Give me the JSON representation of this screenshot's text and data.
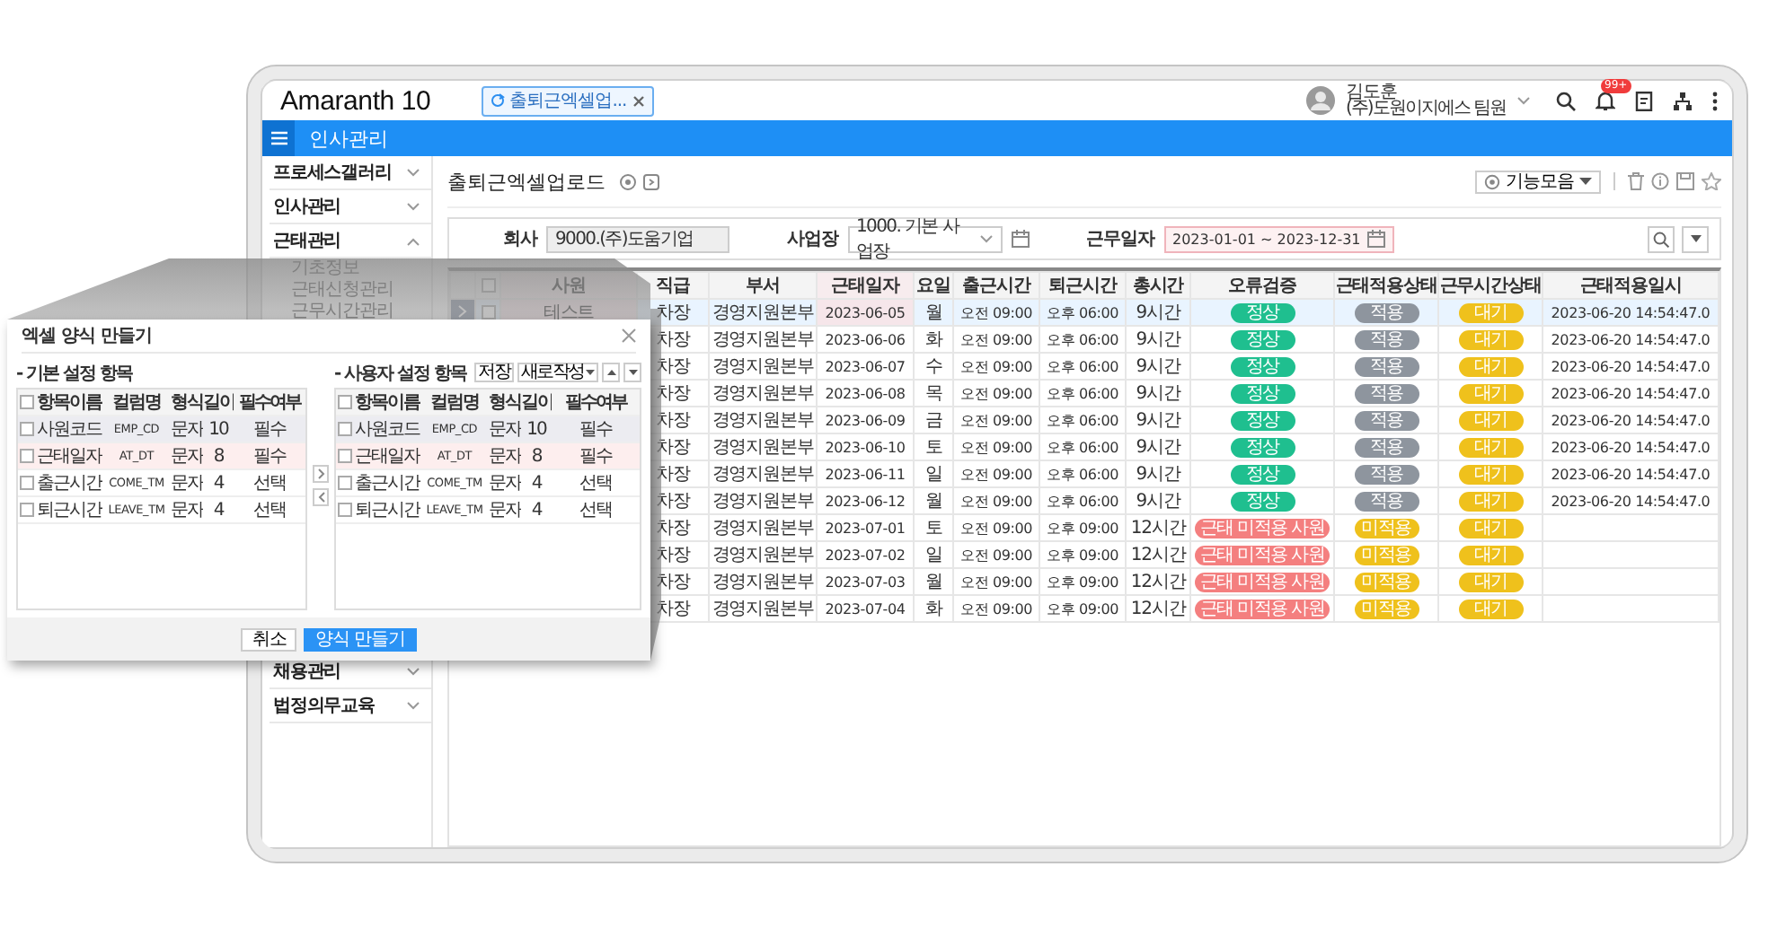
{
  "app": {
    "logo": "Amaranth 10",
    "tab": {
      "label": "출퇴근엑셀업...",
      "selected": true
    },
    "user": {
      "name": "김도훈",
      "company": "(주)도원이지에스 팀원"
    },
    "notification_badge": "99+"
  },
  "menu_bar": {
    "title": "인사관리"
  },
  "sidebar": {
    "items": [
      {
        "label": "프로세스갤러리",
        "expanded": false
      },
      {
        "label": "인사관리",
        "expanded": false
      },
      {
        "label": "근태관리",
        "expanded": true,
        "children": [
          {
            "label": "기초정보"
          },
          {
            "label": "근태신청관리"
          },
          {
            "label": "근무시간관리"
          }
        ]
      }
    ],
    "bottom_items": [
      {
        "label": "채용관리",
        "expanded": false
      },
      {
        "label": "법정의무교육",
        "expanded": false
      }
    ]
  },
  "page": {
    "title": "출퇴근엑셀업로드",
    "tools_button": "기능모음"
  },
  "filters": [
    {
      "label": "회사",
      "value": "9000.(주)도움기업",
      "kind": "readonly"
    },
    {
      "label": "사업장",
      "value": "1000. 기본 사업장",
      "kind": "select"
    },
    {
      "label": "근무일자",
      "value": "2023-01-01 ~ 2023-12-31",
      "kind": "daterange"
    }
  ],
  "table": {
    "all_checked": false,
    "columns": [
      "사원",
      "직급",
      "부서",
      "근태일자",
      "요일",
      "출근시간",
      "퇴근시간",
      "총시간",
      "오류검증",
      "근태적용상태",
      "근무시간상태",
      "근태적용일시"
    ],
    "rows": [
      {
        "selected": true,
        "checked": false,
        "employee": "테스트",
        "rank": "차장",
        "dept": "경영지원본부",
        "date": "2023-06-05",
        "day": "월",
        "in": "오전 09:00",
        "out": "오후 06:00",
        "total": "9시간",
        "check": {
          "text": "정상",
          "color": "#1fbf8f"
        },
        "apply": {
          "text": "적용",
          "color": "#8e959e"
        },
        "work": {
          "text": "대기",
          "color": "#efc11c"
        },
        "applied_at": "2023-06-20 14:54:47.0"
      },
      {
        "selected": false,
        "rank": "차장",
        "dept": "경영지원본부",
        "date": "2023-06-06",
        "day": "화",
        "in": "오전 09:00",
        "out": "오후 06:00",
        "total": "9시간",
        "check": {
          "text": "정상",
          "color": "#1fbf8f"
        },
        "apply": {
          "text": "적용",
          "color": "#8e959e"
        },
        "work": {
          "text": "대기",
          "color": "#efc11c"
        },
        "applied_at": "2023-06-20 14:54:47.0"
      },
      {
        "selected": false,
        "rank": "차장",
        "dept": "경영지원본부",
        "date": "2023-06-07",
        "day": "수",
        "in": "오전 09:00",
        "out": "오후 06:00",
        "total": "9시간",
        "check": {
          "text": "정상",
          "color": "#1fbf8f"
        },
        "apply": {
          "text": "적용",
          "color": "#8e959e"
        },
        "work": {
          "text": "대기",
          "color": "#efc11c"
        },
        "applied_at": "2023-06-20 14:54:47.0"
      },
      {
        "selected": false,
        "rank": "차장",
        "dept": "경영지원본부",
        "date": "2023-06-08",
        "day": "목",
        "in": "오전 09:00",
        "out": "오후 06:00",
        "total": "9시간",
        "check": {
          "text": "정상",
          "color": "#1fbf8f"
        },
        "apply": {
          "text": "적용",
          "color": "#8e959e"
        },
        "work": {
          "text": "대기",
          "color": "#efc11c"
        },
        "applied_at": "2023-06-20 14:54:47.0"
      },
      {
        "selected": false,
        "rank": "차장",
        "dept": "경영지원본부",
        "date": "2023-06-09",
        "day": "금",
        "in": "오전 09:00",
        "out": "오후 06:00",
        "total": "9시간",
        "check": {
          "text": "정상",
          "color": "#1fbf8f"
        },
        "apply": {
          "text": "적용",
          "color": "#8e959e"
        },
        "work": {
          "text": "대기",
          "color": "#efc11c"
        },
        "applied_at": "2023-06-20 14:54:47.0"
      },
      {
        "selected": false,
        "rank": "차장",
        "dept": "경영지원본부",
        "date": "2023-06-10",
        "day": "토",
        "in": "오전 09:00",
        "out": "오후 06:00",
        "total": "9시간",
        "check": {
          "text": "정상",
          "color": "#1fbf8f"
        },
        "apply": {
          "text": "적용",
          "color": "#8e959e"
        },
        "work": {
          "text": "대기",
          "color": "#efc11c"
        },
        "applied_at": "2023-06-20 14:54:47.0"
      },
      {
        "selected": false,
        "rank": "차장",
        "dept": "경영지원본부",
        "date": "2023-06-11",
        "day": "일",
        "in": "오전 09:00",
        "out": "오후 06:00",
        "total": "9시간",
        "check": {
          "text": "정상",
          "color": "#1fbf8f"
        },
        "apply": {
          "text": "적용",
          "color": "#8e959e"
        },
        "work": {
          "text": "대기",
          "color": "#efc11c"
        },
        "applied_at": "2023-06-20 14:54:47.0"
      },
      {
        "selected": false,
        "rank": "차장",
        "dept": "경영지원본부",
        "date": "2023-06-12",
        "day": "월",
        "in": "오전 09:00",
        "out": "오후 06:00",
        "total": "9시간",
        "check": {
          "text": "정상",
          "color": "#1fbf8f"
        },
        "apply": {
          "text": "적용",
          "color": "#8e959e"
        },
        "work": {
          "text": "대기",
          "color": "#efc11c"
        },
        "applied_at": "2023-06-20 14:54:47.0"
      },
      {
        "selected": false,
        "rank": "차장",
        "dept": "경영지원본부",
        "date": "2023-07-01",
        "day": "토",
        "in": "오전 09:00",
        "out": "오후 09:00",
        "total": "12시간",
        "check": {
          "text": "근태 미적용 사원",
          "color": "#f47f7f"
        },
        "apply": {
          "text": "미적용",
          "color": "#efc11c"
        },
        "work": {
          "text": "대기",
          "color": "#efc11c"
        }
      },
      {
        "selected": false,
        "rank": "차장",
        "dept": "경영지원본부",
        "date": "2023-07-02",
        "day": "일",
        "in": "오전 09:00",
        "out": "오후 09:00",
        "total": "12시간",
        "check": {
          "text": "근태 미적용 사원",
          "color": "#f47f7f"
        },
        "apply": {
          "text": "미적용",
          "color": "#efc11c"
        },
        "work": {
          "text": "대기",
          "color": "#efc11c"
        }
      },
      {
        "selected": false,
        "rank": "차장",
        "dept": "경영지원본부",
        "date": "2023-07-03",
        "day": "월",
        "in": "오전 09:00",
        "out": "오후 09:00",
        "total": "12시간",
        "check": {
          "text": "근태 미적용 사원",
          "color": "#f47f7f"
        },
        "apply": {
          "text": "미적용",
          "color": "#efc11c"
        },
        "work": {
          "text": "대기",
          "color": "#efc11c"
        }
      },
      {
        "selected": false,
        "rank": "차장",
        "dept": "경영지원본부",
        "date": "2023-07-04",
        "day": "화",
        "in": "오전 09:00",
        "out": "오후 09:00",
        "total": "12시간",
        "check": {
          "text": "근태 미적용 사원",
          "color": "#f47f7f"
        },
        "apply": {
          "text": "미적용",
          "color": "#efc11c"
        },
        "work": {
          "text": "대기",
          "color": "#efc11c"
        }
      }
    ]
  },
  "dialog": {
    "title": "엑셀 양식 만들기",
    "left_panel": {
      "title": "- 기본 설정 항목",
      "all_checked": false,
      "columns": [
        "항목이름",
        "컬럼명",
        "형식",
        "길이",
        "필수여부"
      ],
      "rows": [
        {
          "checked": false,
          "color": "#ececf1",
          "cells": [
            "사원코드",
            "EMP_CD",
            "문자",
            "10",
            "필수"
          ]
        },
        {
          "checked": false,
          "color": "#fdeeee",
          "cells": [
            "근태일자",
            "AT_DT",
            "문자",
            "8",
            "필수"
          ]
        },
        {
          "checked": false,
          "cells": [
            "출근시간",
            "COME_TM",
            "문자",
            "4",
            "선택"
          ]
        },
        {
          "checked": false,
          "cells": [
            "퇴근시간",
            "LEAVE_TM",
            "문자",
            "4",
            "선택"
          ]
        }
      ]
    },
    "right_panel": {
      "title": "- 사용자 설정 항목",
      "buttons": [
        {
          "label": "저장",
          "kind": "plain"
        },
        {
          "label": "새로작성",
          "kind": "dropdown"
        }
      ],
      "all_checked": false,
      "columns": [
        "항목이름",
        "컬럼명",
        "형식",
        "길이",
        "필수여부"
      ],
      "rows": [
        {
          "checked": false,
          "color": "#ececf1",
          "cells": [
            "사원코드",
            "EMP_CD",
            "문자",
            "10",
            "필수"
          ]
        },
        {
          "checked": false,
          "color": "#fdeeee",
          "cells": [
            "근태일자",
            "AT_DT",
            "문자",
            "8",
            "필수"
          ]
        },
        {
          "checked": false,
          "cells": [
            "출근시간",
            "COME_TM",
            "문자",
            "4",
            "선택"
          ]
        },
        {
          "checked": false,
          "cells": [
            "퇴근시간",
            "LEAVE_TM",
            "문자",
            "4",
            "선택"
          ]
        }
      ]
    },
    "buttons": [
      {
        "label": "취소",
        "primary": false
      },
      {
        "label": "양식 만들기",
        "primary": true
      }
    ]
  }
}
